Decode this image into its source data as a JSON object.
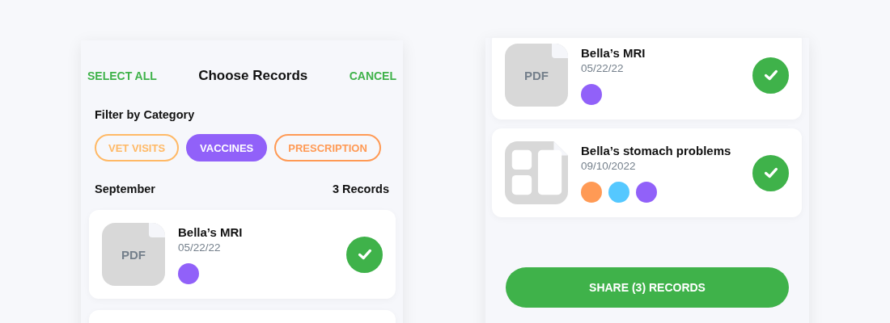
{
  "screens": [
    {
      "kind": "chooser",
      "header": {
        "left_action": "SELECT ALL",
        "title": "Choose Records",
        "right_action": "CANCEL"
      },
      "filter_label": "Filter by Category",
      "chips": [
        {
          "label": "VET VISITS",
          "selected": false,
          "color": "#ffb966"
        },
        {
          "label": "VACCINES",
          "selected": true,
          "color": "#9161f9"
        },
        {
          "label": "PRESCRIPTION",
          "selected": false,
          "color": "#ff9a55"
        }
      ],
      "section": {
        "month": "September",
        "count": "3 Records"
      },
      "records": [
        {
          "title": "Bella’s MRI",
          "date": "05/22/22",
          "kind": "pdf",
          "file_label": "PDF",
          "tags": [
            {
              "color": "#9161f9"
            }
          ],
          "selected": true
        }
      ],
      "more_below": true
    },
    {
      "kind": "share",
      "records": [
        {
          "title": "Bella’s MRI",
          "date": "05/22/22",
          "kind": "pdf",
          "file_label": "PDF",
          "tags": [
            {
              "color": "#9161f9"
            }
          ],
          "selected": true
        },
        {
          "title": "Bella’s stomach problems",
          "date": "09/10/2022",
          "kind": "gallery",
          "tags": [
            {
              "color": "#ff9a55"
            },
            {
              "color": "#55c8ff"
            },
            {
              "color": "#9161f9"
            }
          ],
          "selected": true
        }
      ],
      "share_button": "SHARE (3) RECORDS"
    }
  ]
}
